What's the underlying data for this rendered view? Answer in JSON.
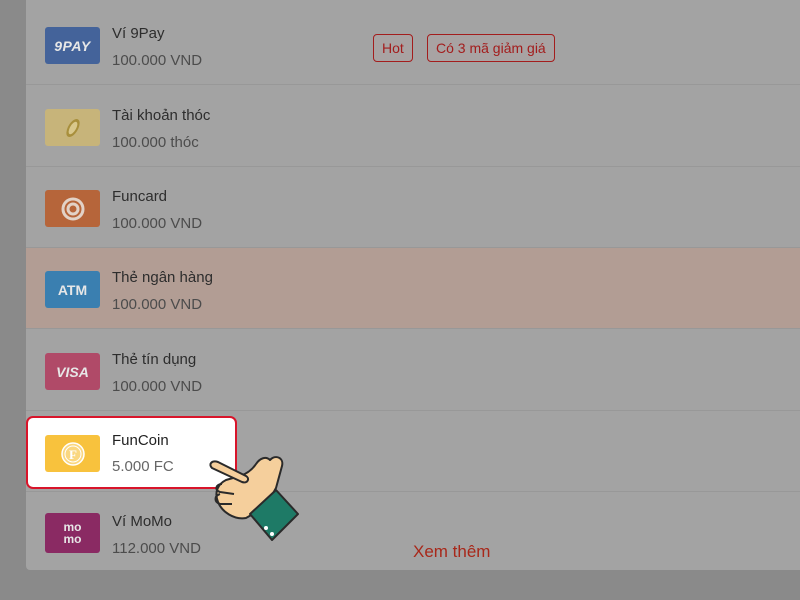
{
  "methods": [
    {
      "name": "Ví 9Pay",
      "amount": "100.000 VND",
      "logo_text": "9PAY"
    },
    {
      "name": "Tài khoản thóc",
      "amount": "100.000 thóc"
    },
    {
      "name": "Funcard",
      "amount": "100.000 VND"
    },
    {
      "name": "Thẻ ngân hàng",
      "amount": "100.000 VND",
      "logo_text": "ATM"
    },
    {
      "name": "Thẻ tín dụng",
      "amount": "100.000 VND",
      "logo_text": "VISA"
    },
    {
      "name": "FunCoin",
      "amount": "5.000 FC",
      "logo_text": "F"
    },
    {
      "name": "Ví MoMo",
      "amount": "112.000 VND",
      "logo_text_1": "mo",
      "logo_text_2": "mo"
    }
  ],
  "badges": {
    "hot": "Hot",
    "coupon": "Có 3 mã giảm giá"
  },
  "see_more": "Xem thêm",
  "colors": {
    "accent_red": "#d8142a",
    "badge_red": "#a31d1d",
    "link_red": "#a8281a",
    "selected_row": "#b29d94",
    "overlay": "#8a8a8a"
  },
  "icons": [
    "9pay-logo-icon",
    "rice-grain-icon",
    "funcard-swirl-icon",
    "atm-card-icon",
    "visa-card-icon",
    "funcoin-icon",
    "momo-logo-icon",
    "pointing-hand-icon"
  ]
}
